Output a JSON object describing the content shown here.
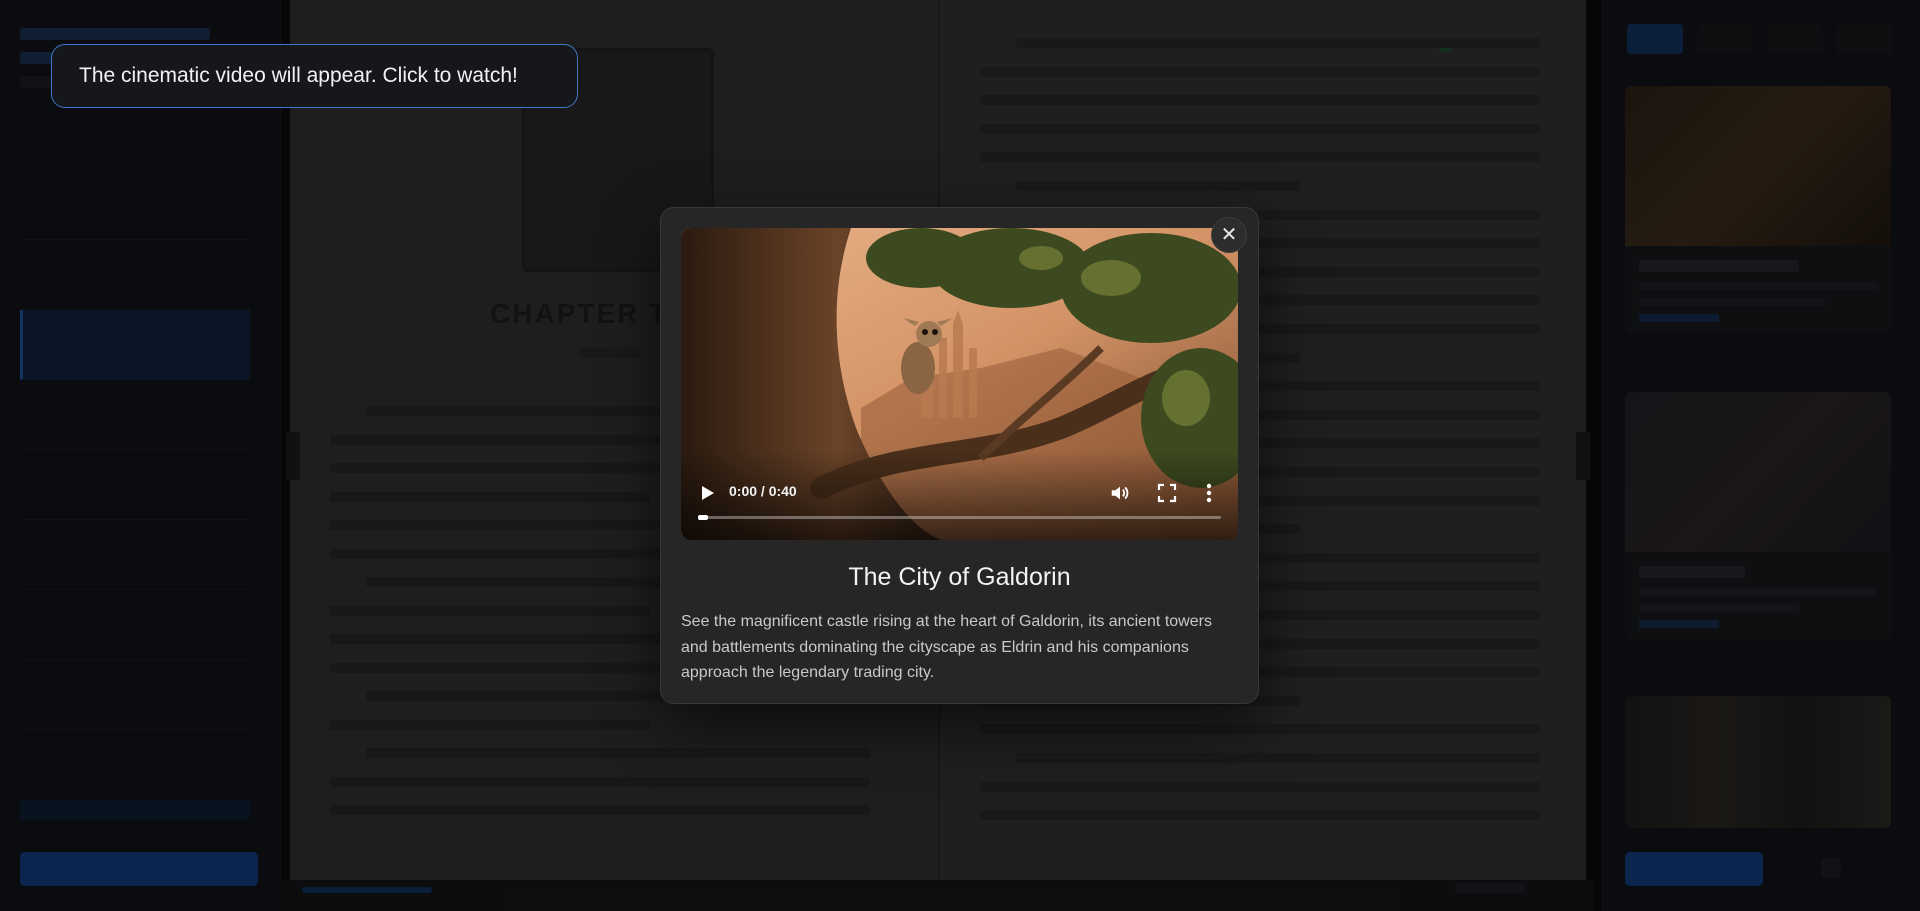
{
  "tooltip": {
    "text": "The cinematic video will appear. Click to watch!"
  },
  "modal": {
    "close_glyph": "✕",
    "title": "The City of Galdorin",
    "description": "See the magnificent castle rising at the heart of Galdorin, its ancient towers and battlements dominating the cityscape as Eldrin and his companions approach the legendary trading city."
  },
  "video": {
    "time_display": "0:00 / 0:40",
    "progress_fraction": 0.0,
    "icons": [
      "play-icon",
      "volume-icon",
      "fullscreen-icon",
      "more-options-icon"
    ]
  },
  "background": {
    "chapter_heading": "CHAPTER T"
  },
  "colors": {
    "tooltip_border": "#3e77c6",
    "modal_bg": "#262626",
    "accent_blue": "#113b78"
  }
}
